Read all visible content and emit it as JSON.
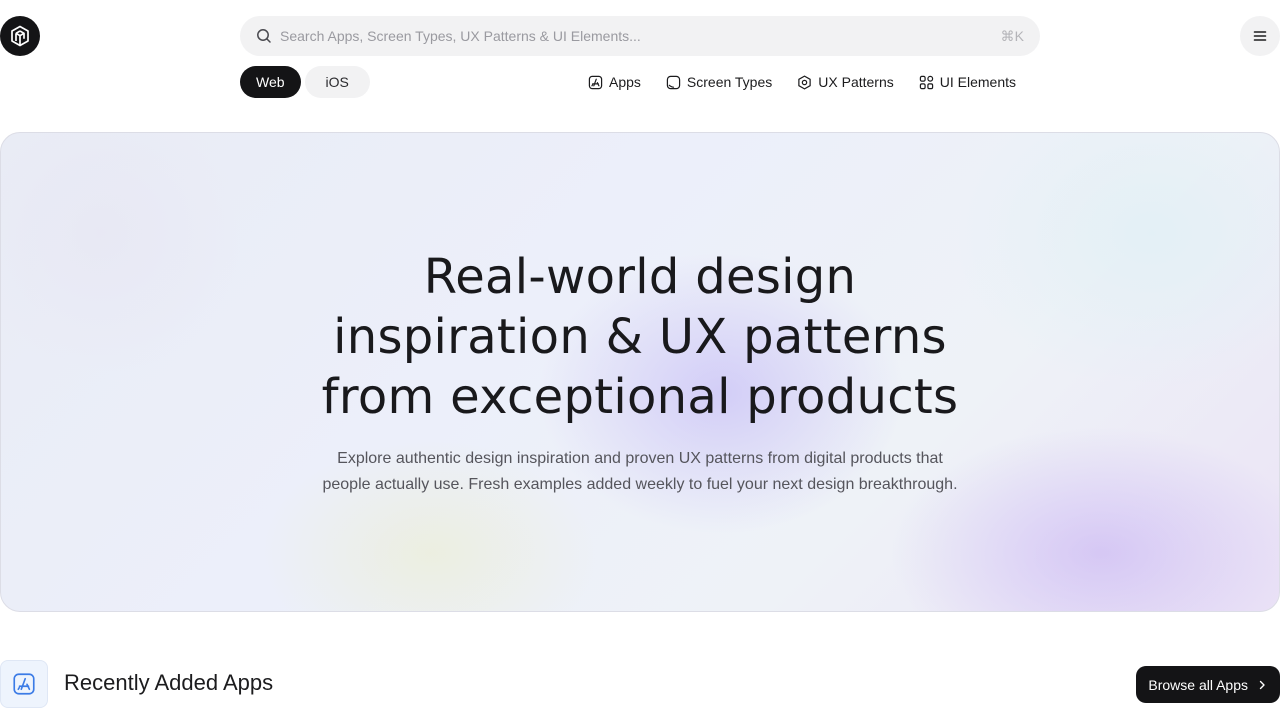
{
  "header": {
    "search": {
      "placeholder": "Search Apps, Screen Types, UX Patterns & UI Elements...",
      "value": "",
      "shortcut": "⌘K"
    }
  },
  "platform_toggle": {
    "options": [
      {
        "label": "Web",
        "selected": true
      },
      {
        "label": "iOS",
        "selected": false
      }
    ]
  },
  "nav": {
    "items": [
      {
        "label": "Apps",
        "icon": "app-store-icon"
      },
      {
        "label": "Screen Types",
        "icon": "screen-icon"
      },
      {
        "label": "UX Patterns",
        "icon": "hexagon-icon"
      },
      {
        "label": "UI Elements",
        "icon": "grid-icon"
      }
    ]
  },
  "hero": {
    "title_lines": [
      "Real-world design",
      "inspiration & UX patterns",
      "from exceptional products"
    ],
    "subtitle_lines": [
      "Explore authentic design inspiration and proven UX patterns from digital products that",
      "people actually use. Fresh examples added weekly to fuel your next design breakthrough."
    ]
  },
  "section": {
    "title": "Recently Added Apps",
    "icon": "app-store-icon",
    "browse_label": "Browse all Apps"
  },
  "colors": {
    "primary_dark": "#141416",
    "pill_light": "#f2f2f3",
    "accent_blue": "#3b7be6"
  }
}
